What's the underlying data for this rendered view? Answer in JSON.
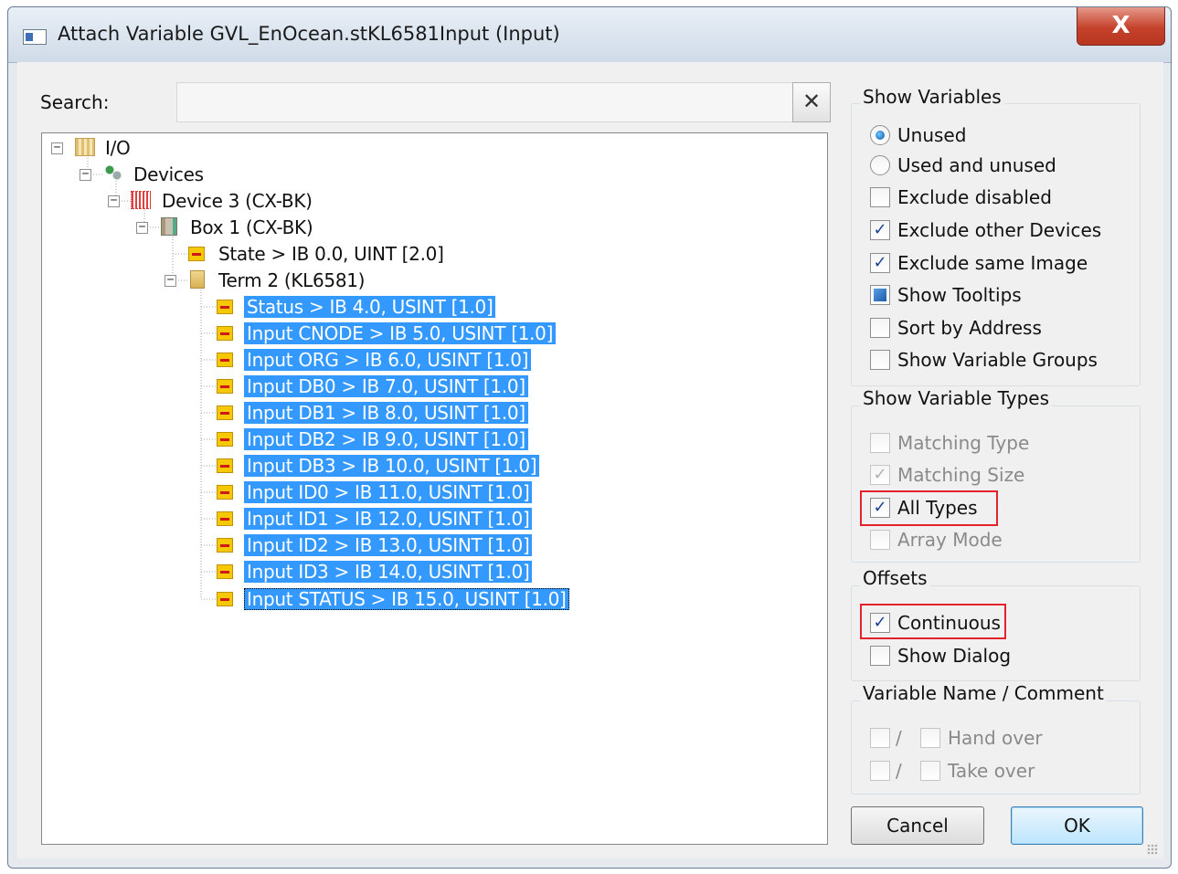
{
  "window": {
    "title": "Attach Variable GVL_EnOcean.stKL6581Input (Input)",
    "close_symbol": "X"
  },
  "search": {
    "label": "Search:",
    "value": "",
    "clear_symbol": "✕"
  },
  "tree": {
    "nodes": [
      {
        "label": "I/O",
        "icon": "io-folder-icon",
        "expander": "minus"
      },
      {
        "label": "Devices",
        "icon": "devices-icon",
        "expander": "minus"
      },
      {
        "label": "Device 3 (CX-BK)",
        "icon": "device-icon",
        "expander": "minus"
      },
      {
        "label": "Box 1 (CX-BK)",
        "icon": "box-icon",
        "expander": "minus"
      },
      {
        "label": "State   >   IB 0.0, UINT [2.0]",
        "icon": "variable-icon"
      },
      {
        "label": "Term 2 (KL6581)",
        "icon": "terminal-icon",
        "expander": "minus"
      },
      {
        "label": "Status   >   IB 4.0, USINT [1.0]",
        "icon": "variable-icon",
        "selected": true
      },
      {
        "label": "Input CNODE   >   IB 5.0, USINT [1.0]",
        "icon": "variable-icon",
        "selected": true
      },
      {
        "label": "Input ORG   >   IB 6.0, USINT [1.0]",
        "icon": "variable-icon",
        "selected": true
      },
      {
        "label": "Input DB0   >   IB 7.0, USINT [1.0]",
        "icon": "variable-icon",
        "selected": true
      },
      {
        "label": "Input DB1   >   IB 8.0, USINT [1.0]",
        "icon": "variable-icon",
        "selected": true
      },
      {
        "label": "Input DB2   >   IB 9.0, USINT [1.0]",
        "icon": "variable-icon",
        "selected": true
      },
      {
        "label": "Input DB3   >   IB 10.0, USINT [1.0]",
        "icon": "variable-icon",
        "selected": true
      },
      {
        "label": "Input ID0   >   IB 11.0, USINT [1.0]",
        "icon": "variable-icon",
        "selected": true
      },
      {
        "label": "Input ID1   >   IB 12.0, USINT [1.0]",
        "icon": "variable-icon",
        "selected": true
      },
      {
        "label": "Input ID2   >   IB 13.0, USINT [1.0]",
        "icon": "variable-icon",
        "selected": true
      },
      {
        "label": "Input ID3   >   IB 14.0, USINT [1.0]",
        "icon": "variable-icon",
        "selected": true
      },
      {
        "label": "Input STATUS   >   IB 15.0, USINT [1.0]",
        "icon": "variable-icon",
        "selected": true,
        "focused": true
      }
    ]
  },
  "show_variables": {
    "title": "Show Variables",
    "unused": "Unused",
    "used_and_unused": "Used and unused",
    "exclude_disabled": "Exclude disabled",
    "exclude_other_devices": "Exclude other Devices",
    "exclude_same_image": "Exclude same Image",
    "show_tooltips": "Show Tooltips",
    "sort_by_address": "Sort by Address",
    "show_variable_groups": "Show Variable Groups"
  },
  "show_variable_types": {
    "title": "Show Variable Types",
    "matching_type": "Matching Type",
    "matching_size": "Matching Size",
    "all_types": "All Types",
    "array_mode": "Array Mode"
  },
  "offsets": {
    "title": "Offsets",
    "continuous": "Continuous",
    "show_dialog": "Show Dialog"
  },
  "variable_name": {
    "title": "Variable Name / Comment",
    "slash": "/",
    "hand_over": "Hand over",
    "take_over": "Take over"
  },
  "buttons": {
    "cancel": "Cancel",
    "ok": "OK"
  },
  "check_mark": "✓",
  "colors": {
    "selection": "#3399ff",
    "highlight": "#e3222b",
    "close_button": "#c5412c"
  }
}
